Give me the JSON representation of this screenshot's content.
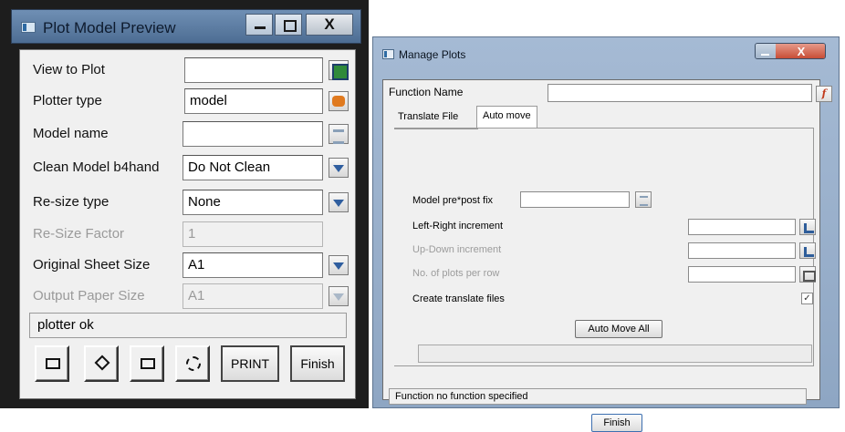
{
  "left_window": {
    "title": "Plot Model Preview",
    "close_glyph": "X",
    "rows": [
      {
        "label": "View to Plot",
        "value": "",
        "button_icon": "map-icon"
      },
      {
        "label": "Plotter type",
        "value": "model",
        "button_icon": "plotter-icon"
      },
      {
        "label": "Model name",
        "value": "",
        "button_icon": "layers-icon"
      },
      {
        "label": "Clean Model b4hand",
        "value": "Do Not Clean",
        "button_icon": "chevron-down-icon"
      },
      {
        "label": "Re-size type",
        "value": "None",
        "button_icon": "chevron-down-icon"
      },
      {
        "label": "Re-Size Factor",
        "value": "1",
        "disabled": true
      },
      {
        "label": "Original Sheet Size",
        "value": "A1",
        "button_icon": "chevron-down-icon"
      },
      {
        "label": "Output Paper Size",
        "value": "A1",
        "disabled": true,
        "button_icon": "chevron-down-icon"
      }
    ],
    "status": "plotter ok",
    "buttons": {
      "print": "PRINT",
      "finish": "Finish"
    }
  },
  "right_window": {
    "title": "Manage Plots",
    "close_glyph": "X",
    "function_name_label": "Function Name",
    "function_name_value": "",
    "fx_icon_text": "f",
    "tabs": [
      {
        "label": "Translate File",
        "active": false
      },
      {
        "label": "Auto move",
        "active": true
      }
    ],
    "fields": [
      {
        "label": "Model pre*post fix",
        "value": ""
      },
      {
        "label": "Left-Right increment",
        "value": ""
      },
      {
        "label": "Up-Down increment",
        "value": "",
        "disabled": true
      },
      {
        "label": "No. of plots per row",
        "value": "",
        "disabled": true
      }
    ],
    "create_translate_label": "Create translate files",
    "create_translate_checked": true,
    "check_glyph": "✓",
    "auto_move_all": "Auto Move All",
    "status": "Function no function specified",
    "finish": "Finish"
  },
  "colors": {
    "title_bar_left": "#5f7fa6",
    "title_bar_right": "#9fb5d0",
    "dialog_bg": "#f0f0f0",
    "dropdown_arrow": "#2f5e9f",
    "close_button_red": "#c4442c"
  }
}
